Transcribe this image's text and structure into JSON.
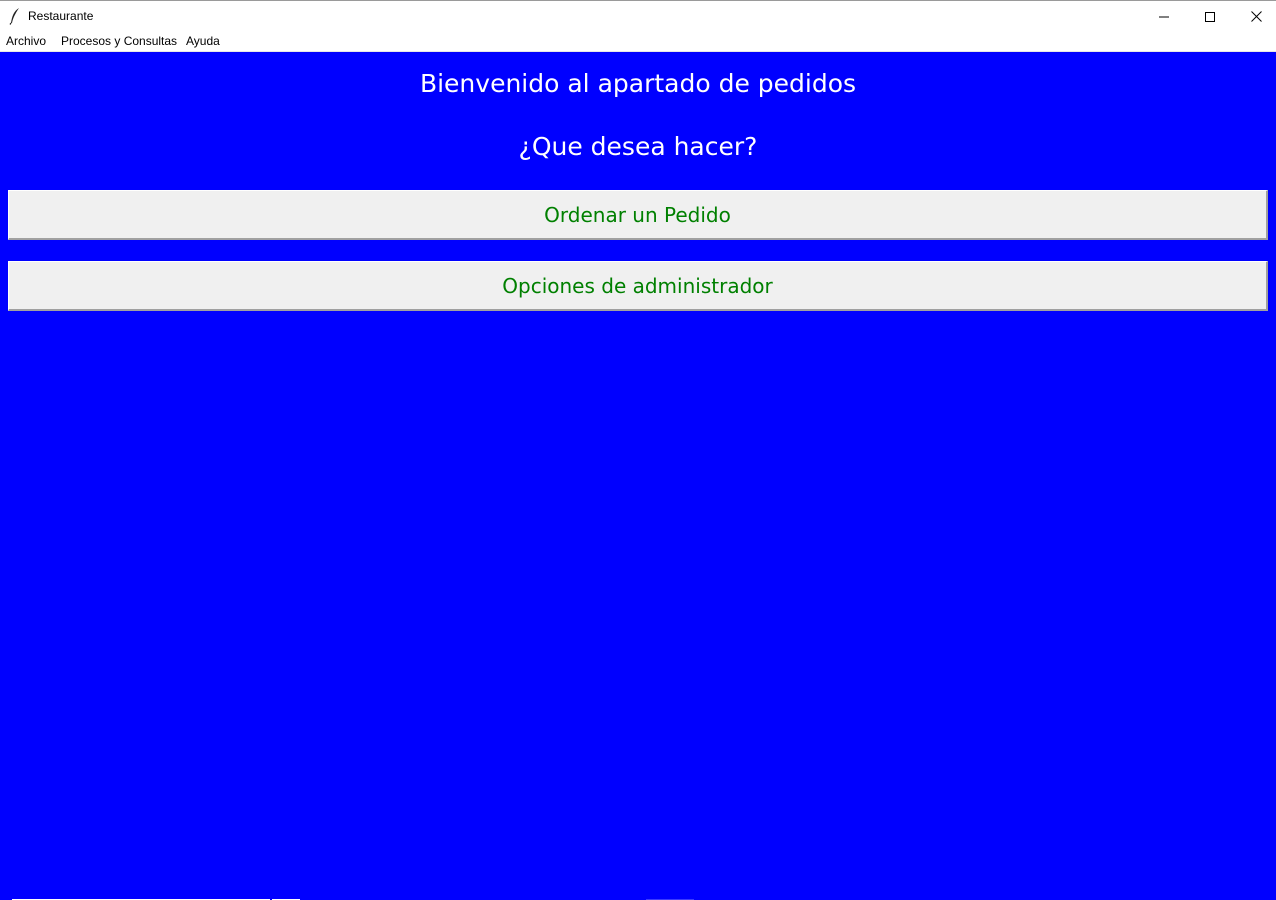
{
  "window": {
    "title": "Restaurante",
    "minimize_symbol": "—",
    "maximize_symbol": "☐",
    "close_symbol": "✕"
  },
  "menu": {
    "items": [
      {
        "label": "Archivo"
      },
      {
        "label": "Procesos y Consultas"
      },
      {
        "label": "Ayuda"
      }
    ]
  },
  "main": {
    "heading": "Bienvenido al apartado de pedidos",
    "subheading": "¿Que desea hacer?",
    "buttons": [
      {
        "label": "Ordenar un Pedido"
      },
      {
        "label": "Opciones de administrador"
      }
    ]
  },
  "colors": {
    "background": "#0000ff",
    "heading_text": "#ffffff",
    "button_text": "#008000",
    "button_bg": "#f0f0f0"
  },
  "icons": {
    "app": "feather-icon",
    "minimize": "minimize-icon",
    "maximize": "maximize-icon",
    "close": "close-icon"
  }
}
